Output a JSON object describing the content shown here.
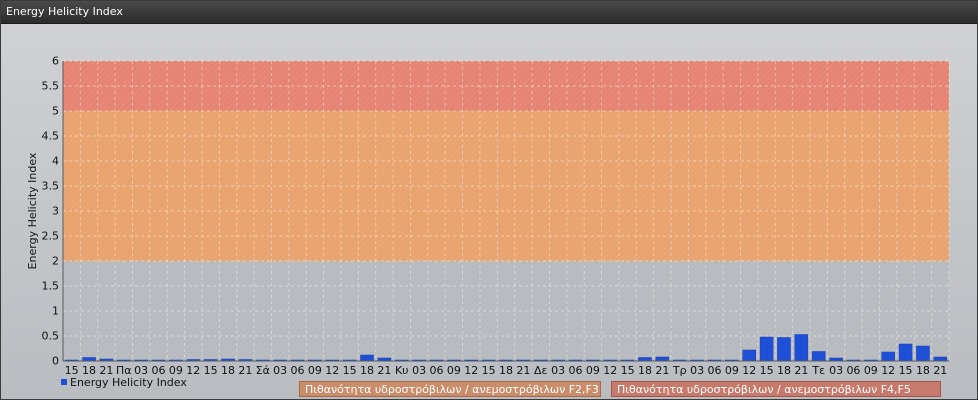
{
  "window": {
    "title": "Energy Helicity Index"
  },
  "chart_data": {
    "type": "bar",
    "ylabel": "Energy Helicity Index",
    "ylim": [
      0,
      6
    ],
    "yticks": [
      0,
      0.5,
      1,
      1.5,
      2,
      2.5,
      3,
      3.5,
      4,
      4.5,
      5,
      5.5,
      6
    ],
    "categories": [
      "15",
      "18",
      "21",
      "Πα",
      "03",
      "06",
      "09",
      "12",
      "15",
      "18",
      "21",
      "Σά",
      "03",
      "06",
      "09",
      "12",
      "15",
      "18",
      "21",
      "Κυ",
      "03",
      "06",
      "09",
      "12",
      "15",
      "18",
      "21",
      "Δε",
      "03",
      "06",
      "09",
      "12",
      "15",
      "18",
      "21",
      "Τρ",
      "03",
      "06",
      "09",
      "12",
      "15",
      "18",
      "21",
      "Τε",
      "03",
      "06",
      "09",
      "12",
      "15",
      "18",
      "21"
    ],
    "series": [
      {
        "name": "Energy Helicity Index",
        "color": "#1f4fd6",
        "values": [
          0.02,
          0.07,
          0.04,
          0.02,
          0.02,
          0.02,
          0.02,
          0.03,
          0.03,
          0.04,
          0.03,
          0.02,
          0.02,
          0.02,
          0.02,
          0.02,
          0.02,
          0.12,
          0.06,
          0.02,
          0.02,
          0.02,
          0.02,
          0.02,
          0.02,
          0.02,
          0.02,
          0.02,
          0.02,
          0.02,
          0.02,
          0.02,
          0.02,
          0.07,
          0.08,
          0.02,
          0.02,
          0.02,
          0.02,
          0.22,
          0.48,
          0.47,
          0.53,
          0.19,
          0.06,
          0.02,
          0.02,
          0.18,
          0.34,
          0.3,
          0.08
        ]
      }
    ],
    "bands": [
      {
        "from": 2,
        "to": 5,
        "color": "#e9a36e",
        "label": "Πιθανότητα υδροστρόβιλων / ανεμοστρόβιλων F2,F3"
      },
      {
        "from": 5,
        "to": 6,
        "color": "#e58472",
        "label": "Πιθανότητα υδροστρόβιλων / ανεμοστρόβιλων F4,F5"
      }
    ],
    "grid": true,
    "legend": "bottom-left"
  }
}
